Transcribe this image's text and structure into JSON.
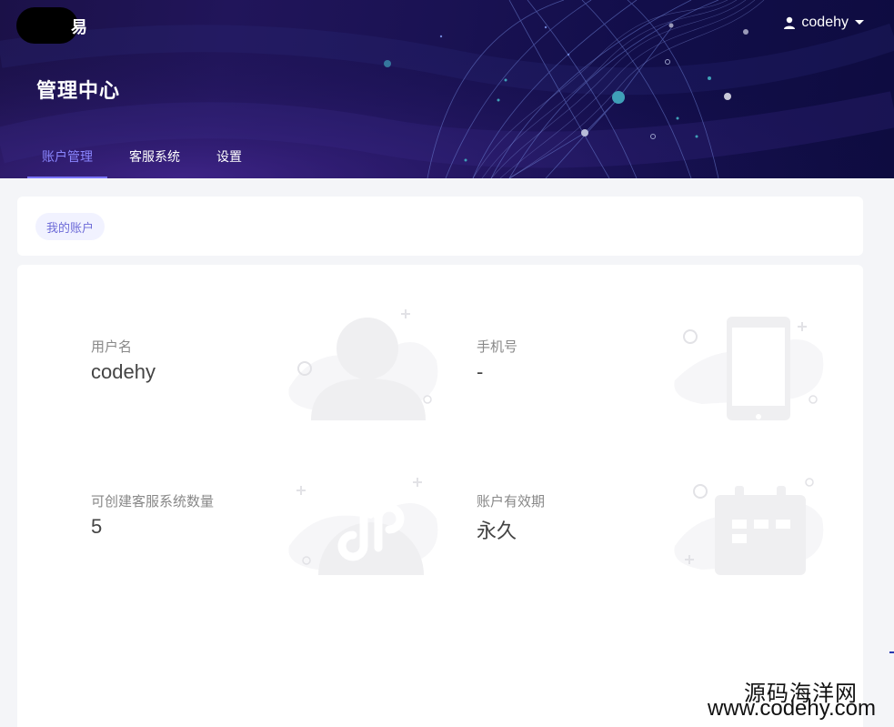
{
  "header": {
    "logo_glyph": "易",
    "username": "codehy",
    "title": "管理中心",
    "tabs": [
      {
        "label": "账户管理",
        "active": true
      },
      {
        "label": "客服系统",
        "active": false
      },
      {
        "label": "设置",
        "active": false
      }
    ]
  },
  "breadcrumb": {
    "label": "我的账户"
  },
  "account": {
    "username": {
      "label": "用户名",
      "value": "codehy",
      "icon": "user-silhouette-icon"
    },
    "phone": {
      "label": "手机号",
      "value": "-",
      "icon": "mobile-phone-icon"
    },
    "quota": {
      "label": "可创建客服系统数量",
      "value": "5",
      "icon": "mini-program-icon"
    },
    "validity": {
      "label": "账户有效期",
      "value": "永久",
      "icon": "calendar-icon"
    }
  },
  "watermark": {
    "cn": "源码海洋网",
    "url": "www.codehy.com"
  },
  "colors": {
    "header_bg": "#1a1253",
    "accent": "#7a73ff",
    "illustration": "#f1f1f3"
  }
}
